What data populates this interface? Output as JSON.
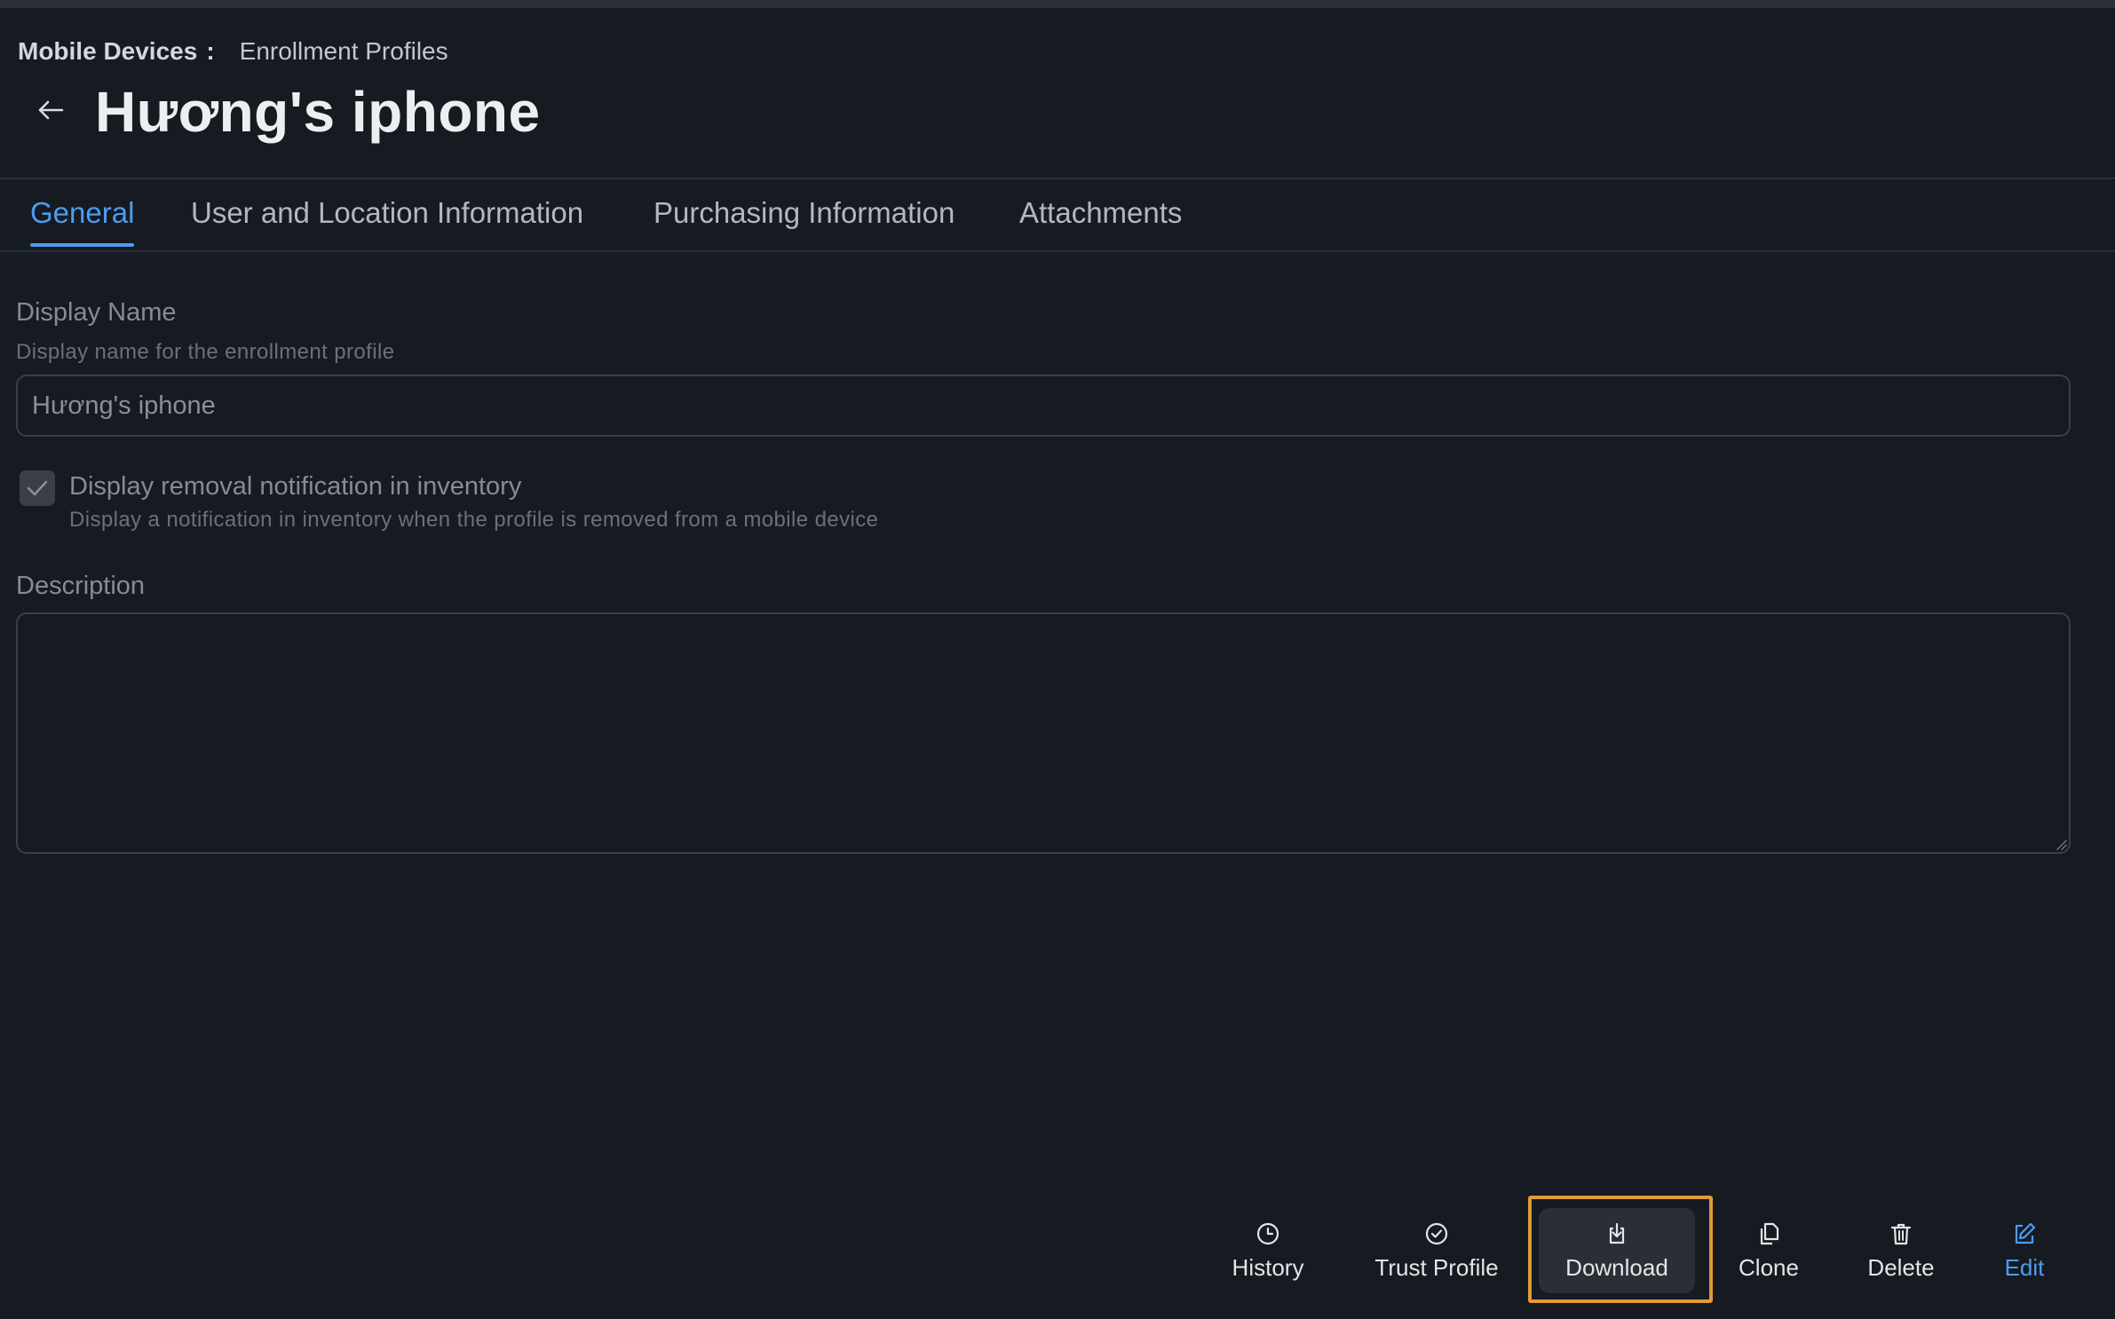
{
  "breadcrumb": {
    "root": "Mobile Devices",
    "separator": ":",
    "current": "Enrollment Profiles"
  },
  "header": {
    "back_icon": "arrow-left-icon",
    "title": "Hương's iphone"
  },
  "tabs": [
    {
      "label": "General",
      "active": true
    },
    {
      "label": "User and Location Information",
      "active": false
    },
    {
      "label": "Purchasing Information",
      "active": false
    },
    {
      "label": "Attachments",
      "active": false
    }
  ],
  "form": {
    "display_name": {
      "label": "Display Name",
      "hint": "Display name for the enrollment profile",
      "value": "Hương's iphone"
    },
    "removal_notification": {
      "label": "Display removal notification in inventory",
      "hint": "Display a notification in inventory when the profile is removed from a mobile device",
      "checked": true
    },
    "description": {
      "label": "Description",
      "value": ""
    }
  },
  "toolbar": {
    "history": {
      "label": "History",
      "icon": "clock-icon"
    },
    "trust_profile": {
      "label": "Trust Profile",
      "icon": "check-circle-icon"
    },
    "download": {
      "label": "Download",
      "icon": "download-icon"
    },
    "clone": {
      "label": "Clone",
      "icon": "copy-icon"
    },
    "delete": {
      "label": "Delete",
      "icon": "trash-icon"
    },
    "edit": {
      "label": "Edit",
      "icon": "edit-icon"
    }
  },
  "colors": {
    "background": "#161a21",
    "accent": "#4d9bf0",
    "highlight_border": "#e39a3a"
  }
}
